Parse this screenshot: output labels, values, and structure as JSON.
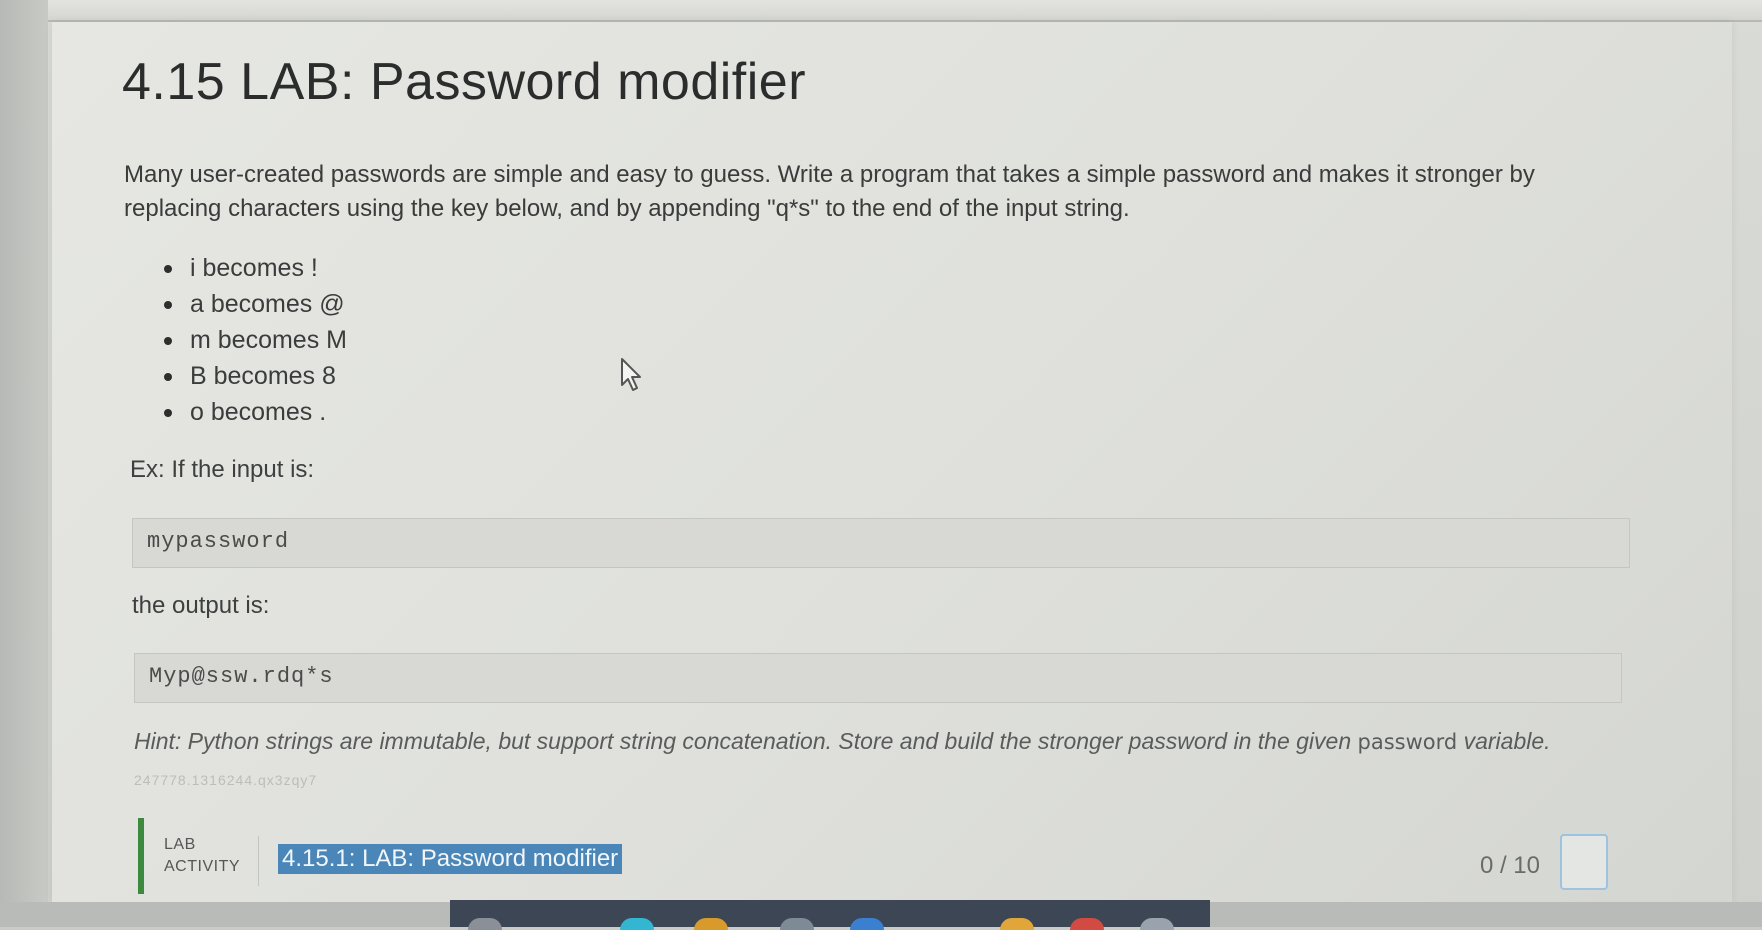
{
  "page": {
    "title": "4.15 LAB: Password modifier",
    "description": "Many user-created passwords are simple and easy to guess. Write a program that takes a simple password and makes it stronger by replacing characters using the key below, and by appending \"q*s\" to the end of the input string."
  },
  "rules": [
    "i becomes !",
    "a becomes @",
    "m becomes M",
    "B becomes 8",
    "o becomes ."
  ],
  "example": {
    "input_label": "Ex: If the input is:",
    "input_value": "mypassword",
    "output_label": "the output is:",
    "output_value": "Myp@ssw.rdq*s"
  },
  "hint": {
    "text": "Hint: Python strings are immutable, but support string concatenation. Store and build the stronger password in the given",
    "code": "password",
    "suffix": "variable."
  },
  "faint_id": "247778.1316244.qx3zqy7",
  "lab": {
    "label_line1": "LAB",
    "label_line2": "ACTIVITY",
    "title": "4.15.1: LAB: Password modifier",
    "score": "0 / 10",
    "accent_color": "#3b8a3e",
    "link_highlight_color": "#4a86b8"
  },
  "icons": {
    "cursor": "mouse-pointer-icon",
    "completion": "checkbox-icon"
  }
}
